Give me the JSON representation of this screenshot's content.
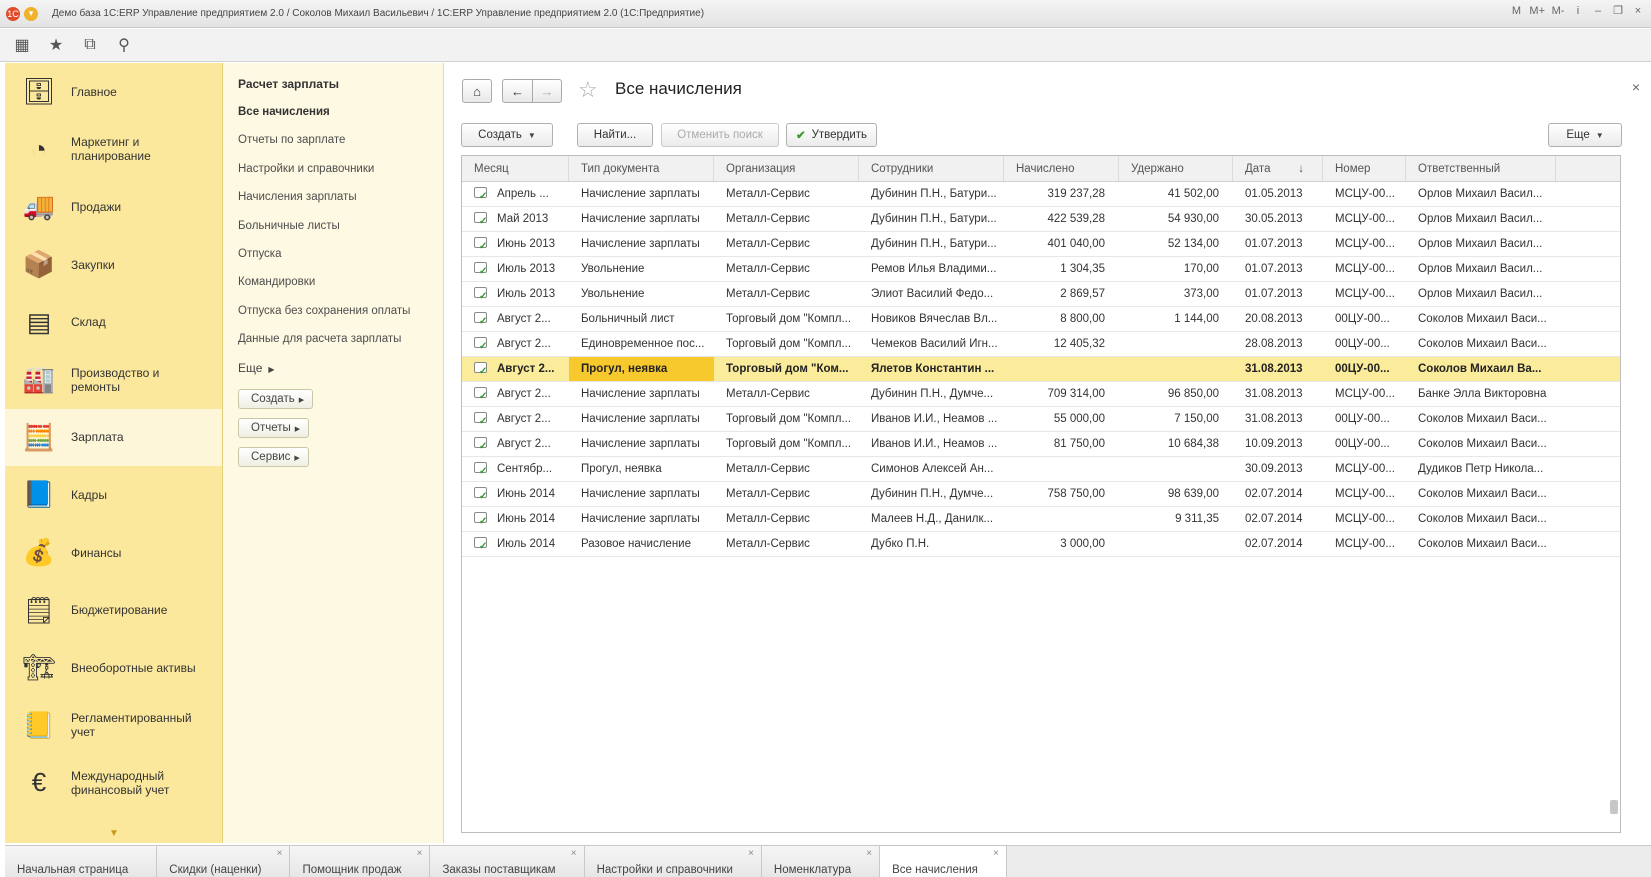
{
  "window": {
    "title": "Демо база 1С:ERP Управление предприятием 2.0 / Соколов Михаил Васильевич / 1С:ERP Управление предприятием 2.0  (1С:Предприятие)",
    "right_controls": [
      "M",
      "M+",
      "M-",
      "i",
      "–",
      "❐",
      "×"
    ]
  },
  "sections": [
    {
      "label": "Главное",
      "icon": "desk-icon"
    },
    {
      "label": "Маркетинг и планирование",
      "icon": "pie-chart-icon"
    },
    {
      "label": "Продажи",
      "icon": "truck-icon"
    },
    {
      "label": "Закупки",
      "icon": "boxes-icon"
    },
    {
      "label": "Склад",
      "icon": "shelves-icon"
    },
    {
      "label": "Производство и ремонты",
      "icon": "factory-icon"
    },
    {
      "label": "Зарплата",
      "icon": "abacus-icon",
      "active": true
    },
    {
      "label": "Кадры",
      "icon": "passport-icon"
    },
    {
      "label": "Финансы",
      "icon": "coins-icon"
    },
    {
      "label": "Бюджетирование",
      "icon": "calculator-icon"
    },
    {
      "label": "Внеоборотные активы",
      "icon": "forklift-icon"
    },
    {
      "label": "Регламентированный учет",
      "icon": "ledger-icon"
    },
    {
      "label": "Международный финансовый учет",
      "icon": "euro-icon"
    }
  ],
  "subpanel": {
    "title": "Расчет зарплаты",
    "links": [
      {
        "label": "Все начисления",
        "bold": true
      },
      {
        "label": "Отчеты по зарплате"
      },
      {
        "label": "Настройки и справочники"
      },
      {
        "label": "Начисления зарплаты"
      },
      {
        "label": "Больничные листы"
      },
      {
        "label": "Отпуска"
      },
      {
        "label": "Командировки"
      },
      {
        "label": "Отпуска без сохранения оплаты"
      },
      {
        "label": "Данные для расчета зарплаты"
      }
    ],
    "more": "Еще",
    "buttons": [
      "Создать",
      "Отчеты",
      "Сервис"
    ]
  },
  "main": {
    "title": "Все начисления",
    "buttons": {
      "create": "Создать",
      "find": "Найти...",
      "cancel_search": "Отменить поиск",
      "approve": "Утвердить",
      "more": "Еще"
    }
  },
  "table": {
    "columns": [
      "Месяц",
      "Тип документа",
      "Организация",
      "Сотрудники",
      "Начислено",
      "Удержано",
      "Дата",
      "Номер",
      "Ответственный"
    ],
    "sort_indicator": "↓",
    "rows": [
      [
        "Апрель ...",
        "Начисление зарплаты",
        "Металл-Сервис",
        "Дубинин П.Н., Батури...",
        "319 237,28",
        "41 502,00",
        "01.05.2013",
        "МСЦУ-00...",
        "Орлов Михаил Васил..."
      ],
      [
        "Май 2013",
        "Начисление зарплаты",
        "Металл-Сервис",
        "Дубинин П.Н., Батури...",
        "422 539,28",
        "54 930,00",
        "30.05.2013",
        "МСЦУ-00...",
        "Орлов Михаил Васил..."
      ],
      [
        "Июнь 2013",
        "Начисление зарплаты",
        "Металл-Сервис",
        "Дубинин П.Н., Батури...",
        "401 040,00",
        "52 134,00",
        "01.07.2013",
        "МСЦУ-00...",
        "Орлов Михаил Васил..."
      ],
      [
        "Июль 2013",
        "Увольнение",
        "Металл-Сервис",
        "Ремов Илья Владими...",
        "1 304,35",
        "170,00",
        "01.07.2013",
        "МСЦУ-00...",
        "Орлов Михаил Васил..."
      ],
      [
        "Июль 2013",
        "Увольнение",
        "Металл-Сервис",
        "Элиот Василий Федо...",
        "2 869,57",
        "373,00",
        "01.07.2013",
        "МСЦУ-00...",
        "Орлов Михаил Васил..."
      ],
      [
        "Август 2...",
        "Больничный лист",
        "Торговый дом \"Компл...",
        "Новиков Вячеслав Вл...",
        "8 800,00",
        "1 144,00",
        "20.08.2013",
        "00ЦУ-00...",
        "Соколов Михаил Васи..."
      ],
      [
        "Август 2...",
        "Единовременное пос...",
        "Торговый дом \"Компл...",
        "Чемеков Василий Игн...",
        "12 405,32",
        "",
        "28.08.2013",
        "00ЦУ-00...",
        "Соколов Михаил Васи..."
      ],
      [
        "Август 2...",
        "Прогул, неявка",
        "Торговый дом \"Ком...",
        "Ялетов Константин ...",
        "",
        "",
        "31.08.2013",
        "00ЦУ-00...",
        "Соколов Михаил Ва..."
      ],
      [
        "Август 2...",
        "Начисление зарплаты",
        "Металл-Сервис",
        "Дубинин П.Н., Думче...",
        "709 314,00",
        "96 850,00",
        "31.08.2013",
        "МСЦУ-00...",
        "Банке Элла Викторовна"
      ],
      [
        "Август 2...",
        "Начисление зарплаты",
        "Торговый дом \"Компл...",
        "Иванов И.И., Неамов ...",
        "55 000,00",
        "7 150,00",
        "31.08.2013",
        "00ЦУ-00...",
        "Соколов Михаил Васи..."
      ],
      [
        "Август 2...",
        "Начисление зарплаты",
        "Торговый дом \"Компл...",
        "Иванов И.И., Неамов ...",
        "81 750,00",
        "10 684,38",
        "10.09.2013",
        "00ЦУ-00...",
        "Соколов Михаил Васи..."
      ],
      [
        "Сентябр...",
        "Прогул, неявка",
        "Металл-Сервис",
        "Симонов Алексей Ан...",
        "",
        "",
        "30.09.2013",
        "МСЦУ-00...",
        "Дудиков Петр Никола..."
      ],
      [
        "Июнь 2014",
        "Начисление зарплаты",
        "Металл-Сервис",
        "Дубинин П.Н., Думче...",
        "758 750,00",
        "98 639,00",
        "02.07.2014",
        "МСЦУ-00...",
        "Соколов Михаил Васи..."
      ],
      [
        "Июнь 2014",
        "Начисление зарплаты",
        "Металл-Сервис",
        "Малеев Н.Д., Данилк...",
        "",
        "9 311,35",
        "02.07.2014",
        "МСЦУ-00...",
        "Соколов Михаил Васи..."
      ],
      [
        "Июль 2014",
        "Разовое начисление",
        "Металл-Сервис",
        "Дубко П.Н.",
        "3 000,00",
        "",
        "02.07.2014",
        "МСЦУ-00...",
        "Соколов Михаил Васи..."
      ]
    ],
    "selected_row": 7
  },
  "tabs": [
    {
      "label": "Начальная страница",
      "closable": false
    },
    {
      "label": "Скидки (наценки)",
      "closable": true
    },
    {
      "label": "Помощник продаж",
      "closable": true
    },
    {
      "label": "Заказы поставщикам",
      "closable": true
    },
    {
      "label": "Настройки и справочники",
      "closable": true
    },
    {
      "label": "Номенклатура",
      "closable": true
    },
    {
      "label": "Все начисления",
      "closable": true,
      "active": true
    }
  ]
}
